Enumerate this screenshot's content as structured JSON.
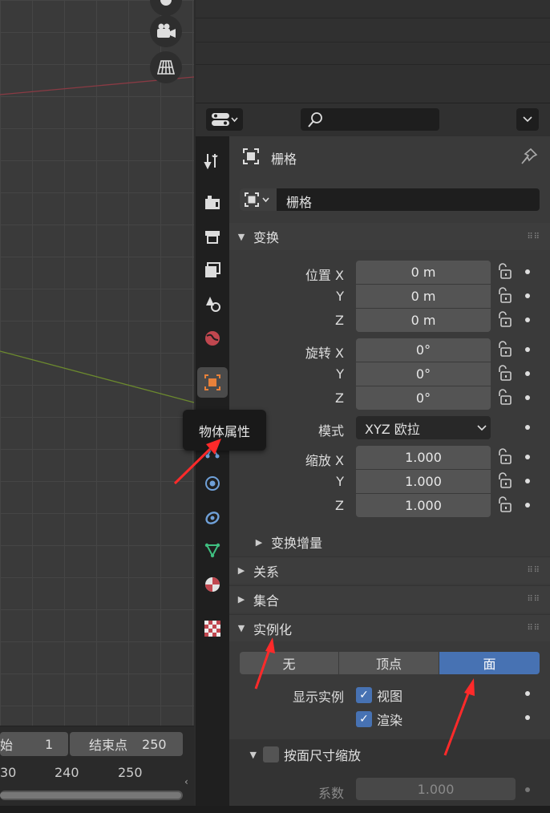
{
  "viewport": {
    "buttons": [
      "camera-icon",
      "perspective-grid-icon"
    ]
  },
  "timeline": {
    "start_label": "始",
    "start_value": "1",
    "end_label": "结束点",
    "end_value": "250",
    "ticks": [
      "30",
      "240",
      "250"
    ]
  },
  "properties": {
    "object_name": "栅格",
    "datablock_name": "栅格",
    "tooltip": "物体属性",
    "transform": {
      "title": "变换",
      "location_label": "位置",
      "rotation_label": "旋转",
      "scale_label": "缩放",
      "axes": [
        "X",
        "Y",
        "Z"
      ],
      "location": [
        "0 m",
        "0 m",
        "0 m"
      ],
      "rotation": [
        "0°",
        "0°",
        "0°"
      ],
      "scale": [
        "1.000",
        "1.000",
        "1.000"
      ],
      "mode_label": "模式",
      "mode_value": "XYZ 欧拉",
      "delta_title": "变换增量"
    },
    "relations": "关系",
    "collections": "集合",
    "instancing": {
      "title": "实例化",
      "options": [
        "无",
        "顶点",
        "面"
      ],
      "selected": "面",
      "show_label": "显示实例",
      "viewport_label": "视图",
      "render_label": "渲染",
      "scale_by_face": "按面尺寸缩放",
      "factor_label": "系数",
      "factor_value": "1.000"
    }
  },
  "colors": {
    "accent": "#4772b3",
    "active_tab": "#e8813a",
    "arrow": "#ff2a2a"
  }
}
